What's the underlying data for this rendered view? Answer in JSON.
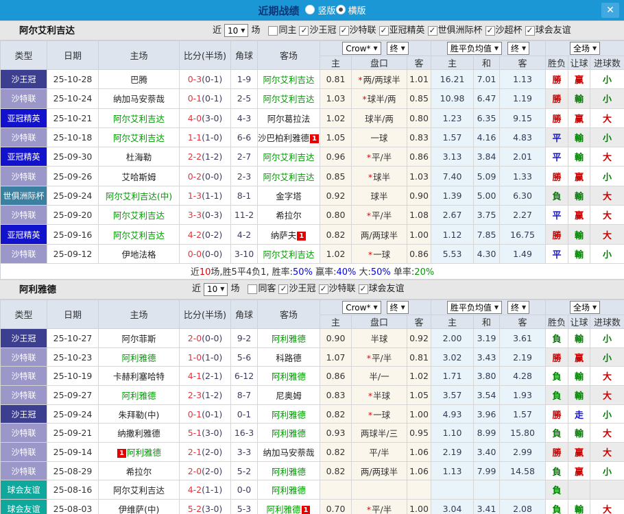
{
  "topbar": {
    "title": "近期战绩",
    "radios": [
      {
        "label": "竖版",
        "selected": false
      },
      {
        "label": "横版",
        "selected": true
      }
    ]
  },
  "ui": {
    "dropdown_arrow": "▼",
    "check_glyph": "✓",
    "close_glyph": "✕",
    "red_card_badge": "1"
  },
  "colors": {
    "topbar_bg": "#1b97d6",
    "team_link_green": "#009900",
    "score_red": "#e8323c",
    "type_colors": {
      "沙王冠": "#3c3f8f",
      "沙特联": "#9b97c8",
      "亚冠精英": "#1212cd",
      "世俱洲际杯": "#3b80a1",
      "球会友谊": "#10a89c"
    },
    "result_colors": {
      "勝": "#cc0000",
      "平": "#1414cc",
      "負": "#008000",
      "赢": "#cc0000",
      "輸": "#008000",
      "走": "#1414cc",
      "大": "#cc0000",
      "小": "#008000"
    }
  },
  "table_header": {
    "left_cols": [
      "类型",
      "日期",
      "主场",
      "比分(半场)",
      "角球",
      "客场"
    ],
    "dropdown_groups": [
      [
        "Crow*",
        "终"
      ],
      [
        "胜平负均值",
        "终"
      ],
      [
        "全场"
      ]
    ],
    "sub_cols": [
      "主",
      "盘口",
      "客",
      "主",
      "和",
      "客",
      "胜负",
      "让球",
      "进球数"
    ]
  },
  "sections": [
    {
      "team": "阿尔艾利吉达",
      "filter": {
        "prefix": "近",
        "games": "10",
        "suffix": "场",
        "checkboxes": [
          {
            "label": "同主",
            "checked": false
          },
          {
            "label": "沙王冠",
            "checked": true
          },
          {
            "label": "沙特联",
            "checked": true
          },
          {
            "label": "亚冠精英",
            "checked": true
          },
          {
            "label": "世俱洲际杯",
            "checked": true
          },
          {
            "label": "沙超杯",
            "checked": true
          },
          {
            "label": "球会友谊",
            "checked": true
          }
        ]
      },
      "rows": [
        {
          "type": "沙王冠",
          "date": "25-10-28",
          "home": "巴腾",
          "home_green": false,
          "home_badge": "",
          "score": "0-3",
          "half": "(0-1)",
          "corner": "1-9",
          "away": "阿尔艾利吉达",
          "away_green": true,
          "away_badge": "",
          "o_home": "0.81",
          "star": true,
          "handicap": "两/两球半",
          "o_away": "1.01",
          "avg_home": "16.21",
          "avg_draw": "7.01",
          "avg_away": "1.13",
          "res_wdl": "勝",
          "res_handicap": "赢",
          "res_goals": "小",
          "shaded": false
        },
        {
          "type": "沙特联",
          "date": "25-10-24",
          "home": "纳加马安萘哉",
          "home_green": false,
          "home_badge": "",
          "score": "0-1",
          "half": "(0-1)",
          "corner": "2-5",
          "away": "阿尔艾利吉达",
          "away_green": true,
          "away_badge": "",
          "o_home": "1.03",
          "star": true,
          "handicap": "球半/两",
          "o_away": "0.85",
          "avg_home": "10.98",
          "avg_draw": "6.47",
          "avg_away": "1.19",
          "res_wdl": "勝",
          "res_handicap": "輸",
          "res_goals": "小",
          "shaded": true
        },
        {
          "type": "亚冠精英",
          "date": "25-10-21",
          "home": "阿尔艾利吉达",
          "home_green": true,
          "home_badge": "",
          "score": "4-0",
          "half": "(3-0)",
          "corner": "4-3",
          "away": "阿尔葛拉法",
          "away_green": false,
          "away_badge": "",
          "o_home": "1.02",
          "star": false,
          "handicap": "球半/两",
          "o_away": "0.80",
          "avg_home": "1.23",
          "avg_draw": "6.35",
          "avg_away": "9.15",
          "res_wdl": "勝",
          "res_handicap": "赢",
          "res_goals": "大",
          "shaded": false
        },
        {
          "type": "沙特联",
          "date": "25-10-18",
          "home": "阿尔艾利吉达",
          "home_green": true,
          "home_badge": "",
          "score": "1-1",
          "half": "(1-0)",
          "corner": "6-6",
          "away": "沙巴柏利雅德",
          "away_green": false,
          "away_badge": "r",
          "o_home": "1.05",
          "star": false,
          "handicap": "一球",
          "o_away": "0.83",
          "avg_home": "1.57",
          "avg_draw": "4.16",
          "avg_away": "4.83",
          "res_wdl": "平",
          "res_handicap": "輸",
          "res_goals": "小",
          "shaded": true
        },
        {
          "type": "亚冠精英",
          "date": "25-09-30",
          "home": "杜海勒",
          "home_green": false,
          "home_badge": "",
          "score": "2-2",
          "half": "(1-2)",
          "corner": "2-7",
          "away": "阿尔艾利吉达",
          "away_green": true,
          "away_badge": "",
          "o_home": "0.96",
          "star": true,
          "handicap": "平/半",
          "o_away": "0.86",
          "avg_home": "3.13",
          "avg_draw": "3.84",
          "avg_away": "2.01",
          "res_wdl": "平",
          "res_handicap": "輸",
          "res_goals": "大",
          "shaded": false
        },
        {
          "type": "沙特联",
          "date": "25-09-26",
          "home": "艾哈斯姆",
          "home_green": false,
          "home_badge": "",
          "score": "0-2",
          "half": "(0-0)",
          "corner": "2-3",
          "away": "阿尔艾利吉达",
          "away_green": true,
          "away_badge": "",
          "o_home": "0.85",
          "star": true,
          "handicap": "球半",
          "o_away": "1.03",
          "avg_home": "7.40",
          "avg_draw": "5.09",
          "avg_away": "1.33",
          "res_wdl": "勝",
          "res_handicap": "赢",
          "res_goals": "小",
          "shaded": false
        },
        {
          "type": "世俱洲际杯",
          "date": "25-09-24",
          "home": "阿尔艾利吉达(中)",
          "home_green": true,
          "home_badge": "",
          "score": "1-3",
          "half": "(1-1)",
          "corner": "8-1",
          "away": "金字塔",
          "away_green": false,
          "away_badge": "",
          "o_home": "0.92",
          "star": false,
          "handicap": "球半",
          "o_away": "0.90",
          "avg_home": "1.39",
          "avg_draw": "5.00",
          "avg_away": "6.30",
          "res_wdl": "負",
          "res_handicap": "輸",
          "res_goals": "大",
          "shaded": true
        },
        {
          "type": "沙特联",
          "date": "25-09-20",
          "home": "阿尔艾利吉达",
          "home_green": true,
          "home_badge": "",
          "score": "3-3",
          "half": "(0-3)",
          "corner": "11-2",
          "away": "希拉尔",
          "away_green": false,
          "away_badge": "",
          "o_home": "0.80",
          "star": true,
          "handicap": "平/半",
          "o_away": "1.08",
          "avg_home": "2.67",
          "avg_draw": "3.75",
          "avg_away": "2.27",
          "res_wdl": "平",
          "res_handicap": "赢",
          "res_goals": "大",
          "shaded": false
        },
        {
          "type": "亚冠精英",
          "date": "25-09-16",
          "home": "阿尔艾利吉达",
          "home_green": true,
          "home_badge": "",
          "score": "4-2",
          "half": "(0-2)",
          "corner": "4-2",
          "away": "纳萨夫",
          "away_green": false,
          "away_badge": "r",
          "o_home": "0.82",
          "star": false,
          "handicap": "两/两球半",
          "o_away": "1.00",
          "avg_home": "1.12",
          "avg_draw": "7.85",
          "avg_away": "16.75",
          "res_wdl": "勝",
          "res_handicap": "輸",
          "res_goals": "大",
          "shaded": true
        },
        {
          "type": "沙特联",
          "date": "25-09-12",
          "home": "伊地法格",
          "home_green": false,
          "home_badge": "",
          "score": "0-0",
          "half": "(0-0)",
          "corner": "3-10",
          "away": "阿尔艾利吉达",
          "away_green": true,
          "away_badge": "",
          "o_home": "1.02",
          "star": true,
          "handicap": "一球",
          "o_away": "0.86",
          "avg_home": "5.53",
          "avg_draw": "4.30",
          "avg_away": "1.49",
          "res_wdl": "平",
          "res_handicap": "輸",
          "res_goals": "小",
          "shaded": false
        }
      ],
      "summary": [
        {
          "text": "近",
          "color": "#333333"
        },
        {
          "text": "10",
          "color": "#ee0000"
        },
        {
          "text": "场,胜5平4负1, ",
          "color": "#333333"
        },
        {
          "text": "胜率:",
          "color": "#333333"
        },
        {
          "text": "50%",
          "color": "#0000ee"
        },
        {
          "text": " 赢率:",
          "color": "#333333"
        },
        {
          "text": "40%",
          "color": "#0000ee"
        },
        {
          "text": " 大:",
          "color": "#333333"
        },
        {
          "text": "50%",
          "color": "#0000ee"
        },
        {
          "text": " 单率:",
          "color": "#333333"
        },
        {
          "text": "20%",
          "color": "#009900"
        }
      ]
    },
    {
      "team": "阿利雅德",
      "filter": {
        "prefix": "近",
        "games": "10",
        "suffix": "场",
        "checkboxes": [
          {
            "label": "同客",
            "checked": false
          },
          {
            "label": "沙王冠",
            "checked": true
          },
          {
            "label": "沙特联",
            "checked": true
          },
          {
            "label": "球会友谊",
            "checked": true
          }
        ]
      },
      "rows": [
        {
          "type": "沙王冠",
          "date": "25-10-27",
          "home": "阿尔菲斯",
          "home_green": false,
          "home_badge": "",
          "score": "2-0",
          "half": "(0-0)",
          "corner": "9-2",
          "away": "阿利雅德",
          "away_green": true,
          "away_badge": "",
          "o_home": "0.90",
          "star": false,
          "handicap": "半球",
          "o_away": "0.92",
          "avg_home": "2.00",
          "avg_draw": "3.19",
          "avg_away": "3.61",
          "res_wdl": "負",
          "res_handicap": "輸",
          "res_goals": "小",
          "shaded": false
        },
        {
          "type": "沙特联",
          "date": "25-10-23",
          "home": "阿利雅德",
          "home_green": true,
          "home_badge": "",
          "score": "1-0",
          "half": "(1-0)",
          "corner": "5-6",
          "away": "科路德",
          "away_green": false,
          "away_badge": "",
          "o_home": "1.07",
          "star": true,
          "handicap": "平/半",
          "o_away": "0.81",
          "avg_home": "3.02",
          "avg_draw": "3.43",
          "avg_away": "2.19",
          "res_wdl": "勝",
          "res_handicap": "赢",
          "res_goals": "小",
          "shaded": true
        },
        {
          "type": "沙特联",
          "date": "25-10-19",
          "home": "卡赫利塞哈特",
          "home_green": false,
          "home_badge": "",
          "score": "4-1",
          "half": "(2-1)",
          "corner": "6-12",
          "away": "阿利雅德",
          "away_green": true,
          "away_badge": "",
          "o_home": "0.86",
          "star": false,
          "handicap": "半/一",
          "o_away": "1.02",
          "avg_home": "1.71",
          "avg_draw": "3.80",
          "avg_away": "4.28",
          "res_wdl": "負",
          "res_handicap": "輸",
          "res_goals": "大",
          "shaded": false
        },
        {
          "type": "沙特联",
          "date": "25-09-27",
          "home": "阿利雅德",
          "home_green": true,
          "home_badge": "",
          "score": "2-3",
          "half": "(1-2)",
          "corner": "8-7",
          "away": "尼奥姆",
          "away_green": false,
          "away_badge": "",
          "o_home": "0.83",
          "star": true,
          "handicap": "半球",
          "o_away": "1.05",
          "avg_home": "3.57",
          "avg_draw": "3.54",
          "avg_away": "1.93",
          "res_wdl": "負",
          "res_handicap": "輸",
          "res_goals": "大",
          "shaded": true
        },
        {
          "type": "沙王冠",
          "date": "25-09-24",
          "home": "朱拜勒(中)",
          "home_green": false,
          "home_badge": "",
          "score": "0-1",
          "half": "(0-1)",
          "corner": "0-1",
          "away": "阿利雅德",
          "away_green": true,
          "away_badge": "",
          "o_home": "0.82",
          "star": true,
          "handicap": "一球",
          "o_away": "1.00",
          "avg_home": "4.93",
          "avg_draw": "3.96",
          "avg_away": "1.57",
          "res_wdl": "勝",
          "res_handicap": "走",
          "res_goals": "小",
          "shaded": false
        },
        {
          "type": "沙特联",
          "date": "25-09-21",
          "home": "纳撒利雅德",
          "home_green": false,
          "home_badge": "",
          "score": "5-1",
          "half": "(3-0)",
          "corner": "16-3",
          "away": "阿利雅德",
          "away_green": true,
          "away_badge": "",
          "o_home": "0.93",
          "star": false,
          "handicap": "两球半/三",
          "o_away": "0.95",
          "avg_home": "1.10",
          "avg_draw": "8.99",
          "avg_away": "15.80",
          "res_wdl": "負",
          "res_handicap": "輸",
          "res_goals": "大",
          "shaded": false
        },
        {
          "type": "沙特联",
          "date": "25-09-14",
          "home": "阿利雅德",
          "home_green": true,
          "home_badge": "l",
          "score": "2-1",
          "half": "(2-0)",
          "corner": "3-3",
          "away": "纳加马安萘哉",
          "away_green": false,
          "away_badge": "",
          "o_home": "0.82",
          "star": false,
          "handicap": "平/半",
          "o_away": "1.06",
          "avg_home": "2.19",
          "avg_draw": "3.40",
          "avg_away": "2.99",
          "res_wdl": "勝",
          "res_handicap": "赢",
          "res_goals": "大",
          "shaded": true
        },
        {
          "type": "沙特联",
          "date": "25-08-29",
          "home": "希拉尔",
          "home_green": false,
          "home_badge": "",
          "score": "2-0",
          "half": "(2-0)",
          "corner": "5-2",
          "away": "阿利雅德",
          "away_green": true,
          "away_badge": "",
          "o_home": "0.82",
          "star": false,
          "handicap": "两/两球半",
          "o_away": "1.06",
          "avg_home": "1.13",
          "avg_draw": "7.99",
          "avg_away": "14.58",
          "res_wdl": "負",
          "res_handicap": "赢",
          "res_goals": "小",
          "shaded": false
        },
        {
          "type": "球会友谊",
          "date": "25-08-16",
          "home": "阿尔艾利吉达",
          "home_green": false,
          "home_badge": "",
          "score": "4-2",
          "half": "(1-1)",
          "corner": "0-0",
          "away": "阿利雅德",
          "away_green": true,
          "away_badge": "",
          "o_home": "",
          "star": false,
          "handicap": "",
          "o_away": "",
          "avg_home": "",
          "avg_draw": "",
          "avg_away": "",
          "res_wdl": "負",
          "res_handicap": "",
          "res_goals": "",
          "shaded": true
        },
        {
          "type": "球会友谊",
          "date": "25-08-03",
          "home": "伊维萨(中)",
          "home_green": false,
          "home_badge": "",
          "score": "5-2",
          "half": "(3-0)",
          "corner": "5-3",
          "away": "阿利雅德",
          "away_green": true,
          "away_badge": "r",
          "o_home": "0.70",
          "star": true,
          "handicap": "平/半",
          "o_away": "1.00",
          "avg_home": "3.04",
          "avg_draw": "3.41",
          "avg_away": "2.08",
          "res_wdl": "負",
          "res_handicap": "輸",
          "res_goals": "大",
          "shaded": false
        }
      ]
    }
  ]
}
